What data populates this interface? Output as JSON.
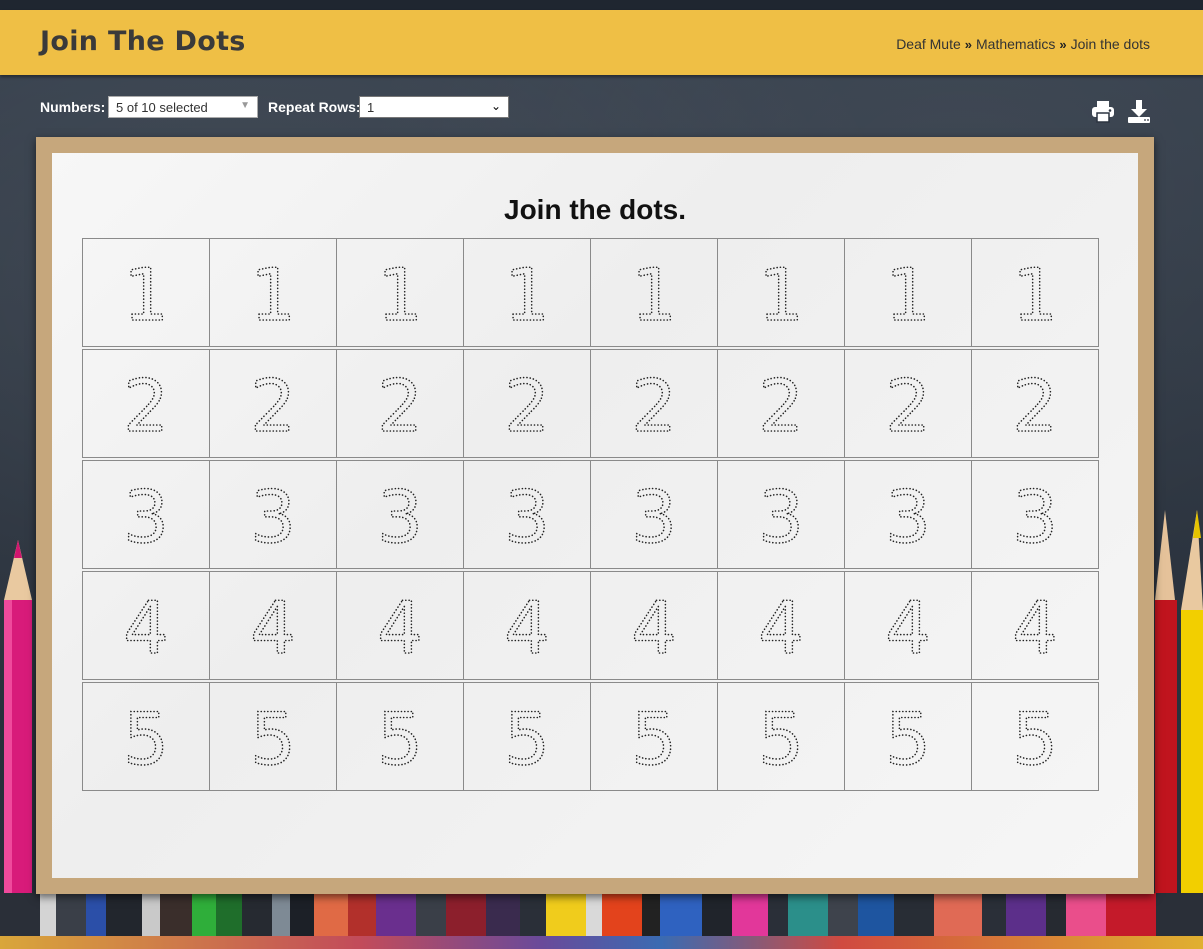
{
  "header": {
    "title": "Join The Dots",
    "breadcrumb": [
      "Deaf Mute",
      "Mathematics",
      "Join the dots"
    ]
  },
  "toolbar": {
    "numbers_label": "Numbers:",
    "numbers_value": "5 of 10 selected",
    "repeat_label": "Repeat Rows:",
    "repeat_value": "1",
    "print_icon": "print-icon",
    "download_icon": "download-icon"
  },
  "worksheet": {
    "title": "Join the dots.",
    "rows": [
      {
        "digit": "1",
        "repeat": 8
      },
      {
        "digit": "2",
        "repeat": 8
      },
      {
        "digit": "3",
        "repeat": 8
      },
      {
        "digit": "4",
        "repeat": 8
      },
      {
        "digit": "5",
        "repeat": 8
      }
    ]
  },
  "colors": {
    "header_bg": "#efbf45",
    "frame": "#c6a77c",
    "paper": "#f3f3f3"
  }
}
